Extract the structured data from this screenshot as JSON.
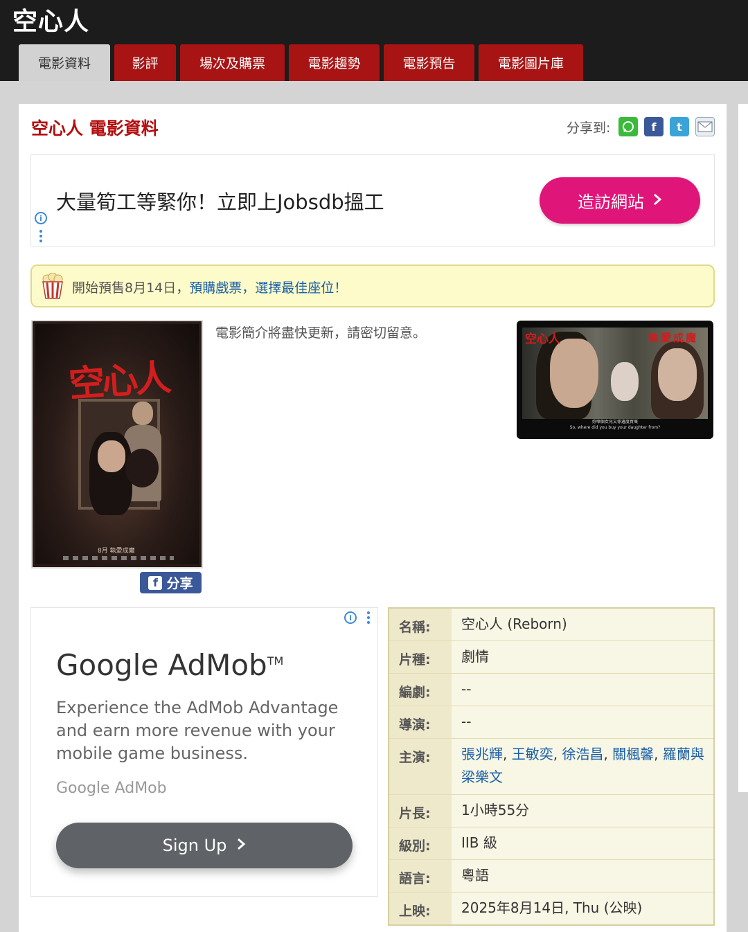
{
  "app": {
    "title": "空心人"
  },
  "tabs": [
    {
      "label": "電影資料",
      "active": true
    },
    {
      "label": "影評"
    },
    {
      "label": "場次及購票"
    },
    {
      "label": "電影趨勢"
    },
    {
      "label": "電影預告"
    },
    {
      "label": "電影圖片庫"
    }
  ],
  "page": {
    "title": "空心人 電影資料",
    "share_label": "分享到:",
    "share_icons": [
      "whatsapp-icon",
      "facebook-icon",
      "twitter-icon",
      "email-icon"
    ]
  },
  "ad_banner": {
    "text": "大量筍工等緊你！立即上Jobsdb搵工",
    "button_label": "造訪網站",
    "button_color": "#e0157a"
  },
  "notice": {
    "prefix": "開始預售8月14日，",
    "link": "預購戲票，選擇最佳座位！"
  },
  "poster": {
    "title_art": "空心人",
    "caption": "8月 執愛成魔",
    "share_label": "分享"
  },
  "synopsis": "電影簡介將盡快更新，請密切留意。",
  "trailer": {
    "title_left": "空心人",
    "title_right": "執愛成魔",
    "subtitle_zh": "妳嗰個女兒又係邊度買嘅",
    "subtitle_en": "So, where did you buy your daughter from?"
  },
  "admob": {
    "title": "Google AdMob",
    "tm": "TM",
    "description": "Experience the AdMob Advantage and earn more revenue with your mobile game business.",
    "brand": "Google AdMob",
    "button_label": "Sign Up"
  },
  "info": {
    "name_label": "名稱:",
    "name": "空心人 (Reborn)",
    "genre_label": "片種:",
    "genre": "劇情",
    "writer_label": "編劇:",
    "writer": "--",
    "director_label": "導演:",
    "director": "--",
    "cast_label": "主演:",
    "cast": [
      "張兆輝",
      "王敏奕",
      "徐浩昌",
      "關楓馨",
      "羅蘭與",
      "梁樂文"
    ],
    "cast_sep": ", ",
    "runtime_label": "片長:",
    "runtime": "1小時55分",
    "rating_label": "級別:",
    "rating": "IIB 級",
    "language_label": "語言:",
    "language": "粵語",
    "release_label": "上映:",
    "release": "2025年8月14日, Thu (公映)"
  },
  "colors": {
    "accent": "#a81414",
    "title_red": "#b40e0e",
    "link": "#1a5fa8"
  }
}
